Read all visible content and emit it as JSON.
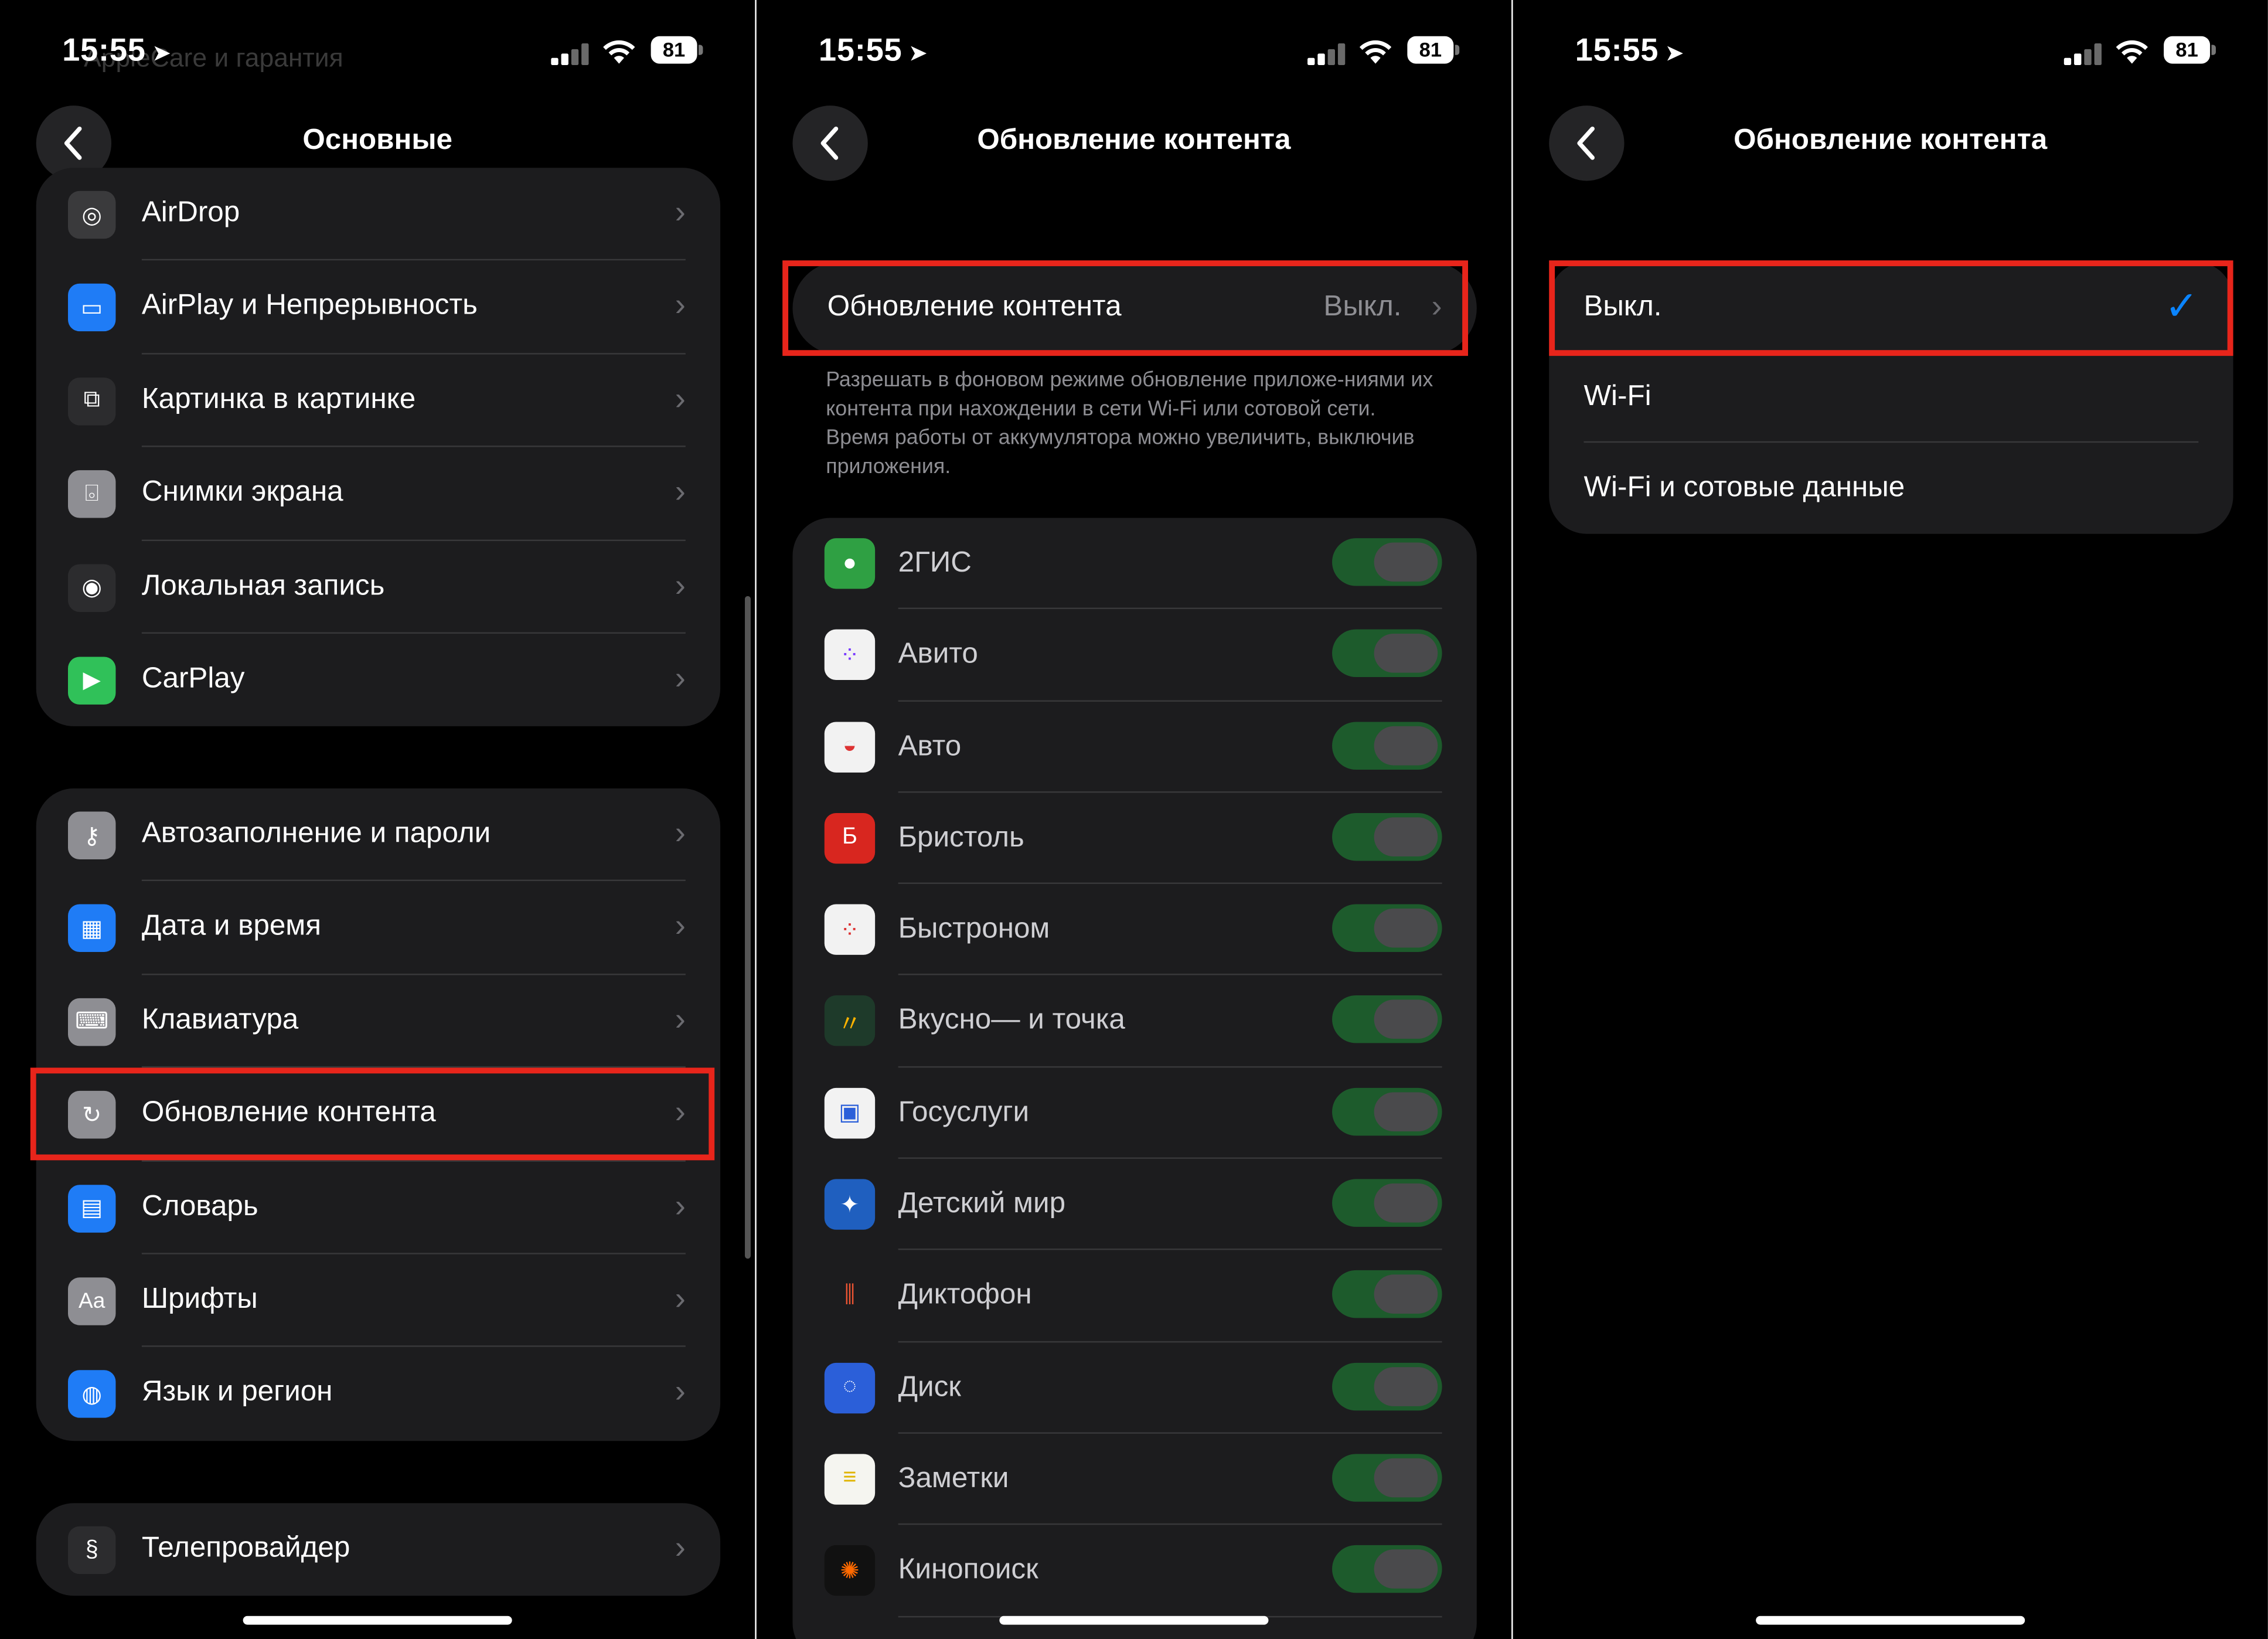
{
  "status": {
    "time": "15:55",
    "battery": "81"
  },
  "screen1": {
    "ghost_text": "AppleCare и гарантия",
    "title": "Основные",
    "group1": [
      {
        "label": "AirDrop",
        "icon": "airdrop-icon",
        "color": "#3a3a3c"
      },
      {
        "label": "AirPlay и Непрерывность",
        "icon": "airplay-icon",
        "color": "#1f7cf6"
      },
      {
        "label": "Картинка в картинке",
        "icon": "pip-icon",
        "color": "#2c2c2e"
      },
      {
        "label": "Снимки экрана",
        "icon": "screenshot-icon",
        "color": "#8e8e93"
      },
      {
        "label": "Локальная запись",
        "icon": "local-capture-icon",
        "color": "#2c2c2e"
      },
      {
        "label": "CarPlay",
        "icon": "carplay-icon",
        "color": "#30c159"
      }
    ],
    "group2": [
      {
        "label": "Автозаполнение и пароли",
        "icon": "key-icon",
        "color": "#8e8e93"
      },
      {
        "label": "Дата и время",
        "icon": "calendar-clock-icon",
        "color": "#1f7cf6"
      },
      {
        "label": "Клавиатура",
        "icon": "keyboard-icon",
        "color": "#8e8e93"
      },
      {
        "label": "Обновление контента",
        "icon": "refresh-icon",
        "color": "#8e8e93"
      },
      {
        "label": "Словарь",
        "icon": "book-icon",
        "color": "#1f7cf6"
      },
      {
        "label": "Шрифты",
        "icon": "fonts-icon",
        "color": "#8e8e93",
        "glyph": "Aa"
      },
      {
        "label": "Язык и регион",
        "icon": "globe-icon",
        "color": "#1f7cf6"
      }
    ],
    "group3": [
      {
        "label": "Телепровайдер",
        "icon": "tv-provider-icon",
        "color": "#2c2c2e"
      }
    ]
  },
  "screen2": {
    "title": "Обновление контента",
    "setting_label": "Обновление контента",
    "setting_value": "Выкл.",
    "description": "Разрешать в фоновом режиме обновление приложе-ниями их контента при нахождении в сети Wi-Fi или сотовой сети. Время работы от аккумулятора можно увеличить, выключив приложения.",
    "apps": [
      {
        "label": "2ГИС",
        "icon": "2gis-icon",
        "color": "#2fa043"
      },
      {
        "label": "Авито",
        "icon": "avito-icon",
        "color": "#f2f2f2"
      },
      {
        "label": "Авто",
        "icon": "auto-icon",
        "color": "#f2f2f2"
      },
      {
        "label": "Бристоль",
        "icon": "bristol-icon",
        "color": "#d8261f"
      },
      {
        "label": "Быстроном",
        "icon": "bystronom-icon",
        "color": "#f2f2f2"
      },
      {
        "label": "Вкусно— и точка",
        "icon": "vkusno-icon",
        "color": "#1e3a2a"
      },
      {
        "label": "Госуслуги",
        "icon": "gosuslugi-icon",
        "color": "#f2f2f2"
      },
      {
        "label": "Детский мир",
        "icon": "detmir-icon",
        "color": "#1f5fbf"
      },
      {
        "label": "Диктофон",
        "icon": "voice-memos-icon",
        "color": "#1c1c1e"
      },
      {
        "label": "Диск",
        "icon": "disk-icon",
        "color": "#2b5fd9"
      },
      {
        "label": "Заметки",
        "icon": "notes-icon",
        "color": "#f5f5f0"
      },
      {
        "label": "Кинопоиск",
        "icon": "kinopoisk-icon",
        "color": "#111"
      }
    ]
  },
  "screen3": {
    "title": "Обновление контента",
    "options": [
      {
        "label": "Выкл.",
        "checked": true
      },
      {
        "label": "Wi-Fi",
        "checked": false
      },
      {
        "label": "Wi-Fi и сотовые данные",
        "checked": false
      }
    ],
    "check_glyph": "✓"
  }
}
